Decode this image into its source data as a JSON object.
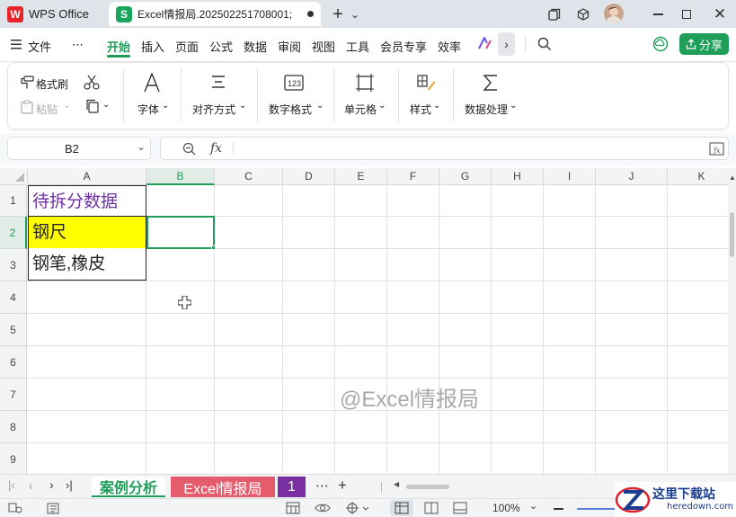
{
  "titlebar": {
    "app_name": "WPS Office",
    "doc_tab": "Excel情报局.202502251708001;",
    "add": "+",
    "chev": "⌄"
  },
  "menu": {
    "file": "文件",
    "more": "⋯",
    "items": [
      "开始",
      "插入",
      "页面",
      "公式",
      "数据",
      "审阅",
      "视图",
      "工具",
      "会员专享",
      "效率"
    ],
    "share": "分享"
  },
  "ribbon": {
    "format_painter": "格式刷",
    "paste": "粘贴",
    "font": "字体",
    "align": "对齐方式",
    "number_format": "数字格式",
    "cell": "单元格",
    "style": "样式",
    "data_processing": "数据处理"
  },
  "formula_bar": {
    "name_box": "B2",
    "fx": "fx",
    "value": ""
  },
  "grid": {
    "columns": [
      "A",
      "B",
      "C",
      "D",
      "E",
      "F",
      "G",
      "H",
      "I",
      "J",
      "K"
    ],
    "rows": [
      "1",
      "2",
      "3",
      "4",
      "5",
      "6",
      "7",
      "8",
      "9"
    ],
    "cells": {
      "A1": "待拆分数据",
      "A2": "钢尺",
      "A3": "钢笔,橡皮"
    },
    "watermark": "@Excel情报局",
    "selected": "B2",
    "colors": {
      "a1_text": "#7030a0",
      "a2_fill": "#ffff00",
      "selection": "#1f9e5a"
    }
  },
  "sheets": {
    "tabs": [
      "案例分析",
      "Excel情报局",
      "1"
    ],
    "active": "案例分析",
    "more": "⋯",
    "add": "+"
  },
  "status": {
    "zoom": "100%"
  },
  "logo": {
    "name": "这里下载站",
    "url": "heredown.com"
  }
}
